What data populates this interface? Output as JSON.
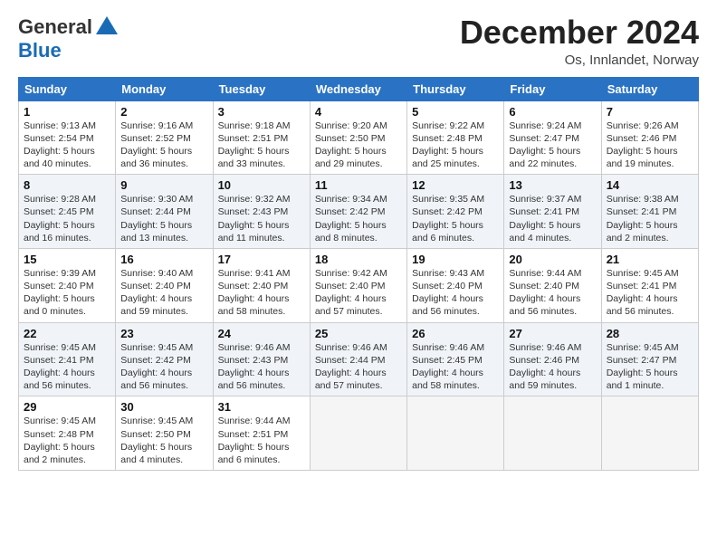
{
  "logo": {
    "line1": "General",
    "line2": "Blue"
  },
  "header": {
    "month": "December 2024",
    "location": "Os, Innlandet, Norway"
  },
  "weekdays": [
    "Sunday",
    "Monday",
    "Tuesday",
    "Wednesday",
    "Thursday",
    "Friday",
    "Saturday"
  ],
  "weeks": [
    [
      {
        "day": "1",
        "sunrise": "9:13 AM",
        "sunset": "2:54 PM",
        "daylight": "5 hours and 40 minutes."
      },
      {
        "day": "2",
        "sunrise": "9:16 AM",
        "sunset": "2:52 PM",
        "daylight": "5 hours and 36 minutes."
      },
      {
        "day": "3",
        "sunrise": "9:18 AM",
        "sunset": "2:51 PM",
        "daylight": "5 hours and 33 minutes."
      },
      {
        "day": "4",
        "sunrise": "9:20 AM",
        "sunset": "2:50 PM",
        "daylight": "5 hours and 29 minutes."
      },
      {
        "day": "5",
        "sunrise": "9:22 AM",
        "sunset": "2:48 PM",
        "daylight": "5 hours and 25 minutes."
      },
      {
        "day": "6",
        "sunrise": "9:24 AM",
        "sunset": "2:47 PM",
        "daylight": "5 hours and 22 minutes."
      },
      {
        "day": "7",
        "sunrise": "9:26 AM",
        "sunset": "2:46 PM",
        "daylight": "5 hours and 19 minutes."
      }
    ],
    [
      {
        "day": "8",
        "sunrise": "9:28 AM",
        "sunset": "2:45 PM",
        "daylight": "5 hours and 16 minutes."
      },
      {
        "day": "9",
        "sunrise": "9:30 AM",
        "sunset": "2:44 PM",
        "daylight": "5 hours and 13 minutes."
      },
      {
        "day": "10",
        "sunrise": "9:32 AM",
        "sunset": "2:43 PM",
        "daylight": "5 hours and 11 minutes."
      },
      {
        "day": "11",
        "sunrise": "9:34 AM",
        "sunset": "2:42 PM",
        "daylight": "5 hours and 8 minutes."
      },
      {
        "day": "12",
        "sunrise": "9:35 AM",
        "sunset": "2:42 PM",
        "daylight": "5 hours and 6 minutes."
      },
      {
        "day": "13",
        "sunrise": "9:37 AM",
        "sunset": "2:41 PM",
        "daylight": "5 hours and 4 minutes."
      },
      {
        "day": "14",
        "sunrise": "9:38 AM",
        "sunset": "2:41 PM",
        "daylight": "5 hours and 2 minutes."
      }
    ],
    [
      {
        "day": "15",
        "sunrise": "9:39 AM",
        "sunset": "2:40 PM",
        "daylight": "5 hours and 0 minutes."
      },
      {
        "day": "16",
        "sunrise": "9:40 AM",
        "sunset": "2:40 PM",
        "daylight": "4 hours and 59 minutes."
      },
      {
        "day": "17",
        "sunrise": "9:41 AM",
        "sunset": "2:40 PM",
        "daylight": "4 hours and 58 minutes."
      },
      {
        "day": "18",
        "sunrise": "9:42 AM",
        "sunset": "2:40 PM",
        "daylight": "4 hours and 57 minutes."
      },
      {
        "day": "19",
        "sunrise": "9:43 AM",
        "sunset": "2:40 PM",
        "daylight": "4 hours and 56 minutes."
      },
      {
        "day": "20",
        "sunrise": "9:44 AM",
        "sunset": "2:40 PM",
        "daylight": "4 hours and 56 minutes."
      },
      {
        "day": "21",
        "sunrise": "9:45 AM",
        "sunset": "2:41 PM",
        "daylight": "4 hours and 56 minutes."
      }
    ],
    [
      {
        "day": "22",
        "sunrise": "9:45 AM",
        "sunset": "2:41 PM",
        "daylight": "4 hours and 56 minutes."
      },
      {
        "day": "23",
        "sunrise": "9:45 AM",
        "sunset": "2:42 PM",
        "daylight": "4 hours and 56 minutes."
      },
      {
        "day": "24",
        "sunrise": "9:46 AM",
        "sunset": "2:43 PM",
        "daylight": "4 hours and 56 minutes."
      },
      {
        "day": "25",
        "sunrise": "9:46 AM",
        "sunset": "2:44 PM",
        "daylight": "4 hours and 57 minutes."
      },
      {
        "day": "26",
        "sunrise": "9:46 AM",
        "sunset": "2:45 PM",
        "daylight": "4 hours and 58 minutes."
      },
      {
        "day": "27",
        "sunrise": "9:46 AM",
        "sunset": "2:46 PM",
        "daylight": "4 hours and 59 minutes."
      },
      {
        "day": "28",
        "sunrise": "9:45 AM",
        "sunset": "2:47 PM",
        "daylight": "5 hours and 1 minute."
      }
    ],
    [
      {
        "day": "29",
        "sunrise": "9:45 AM",
        "sunset": "2:48 PM",
        "daylight": "5 hours and 2 minutes."
      },
      {
        "day": "30",
        "sunrise": "9:45 AM",
        "sunset": "2:50 PM",
        "daylight": "5 hours and 4 minutes."
      },
      {
        "day": "31",
        "sunrise": "9:44 AM",
        "sunset": "2:51 PM",
        "daylight": "5 hours and 6 minutes."
      },
      null,
      null,
      null,
      null
    ]
  ]
}
